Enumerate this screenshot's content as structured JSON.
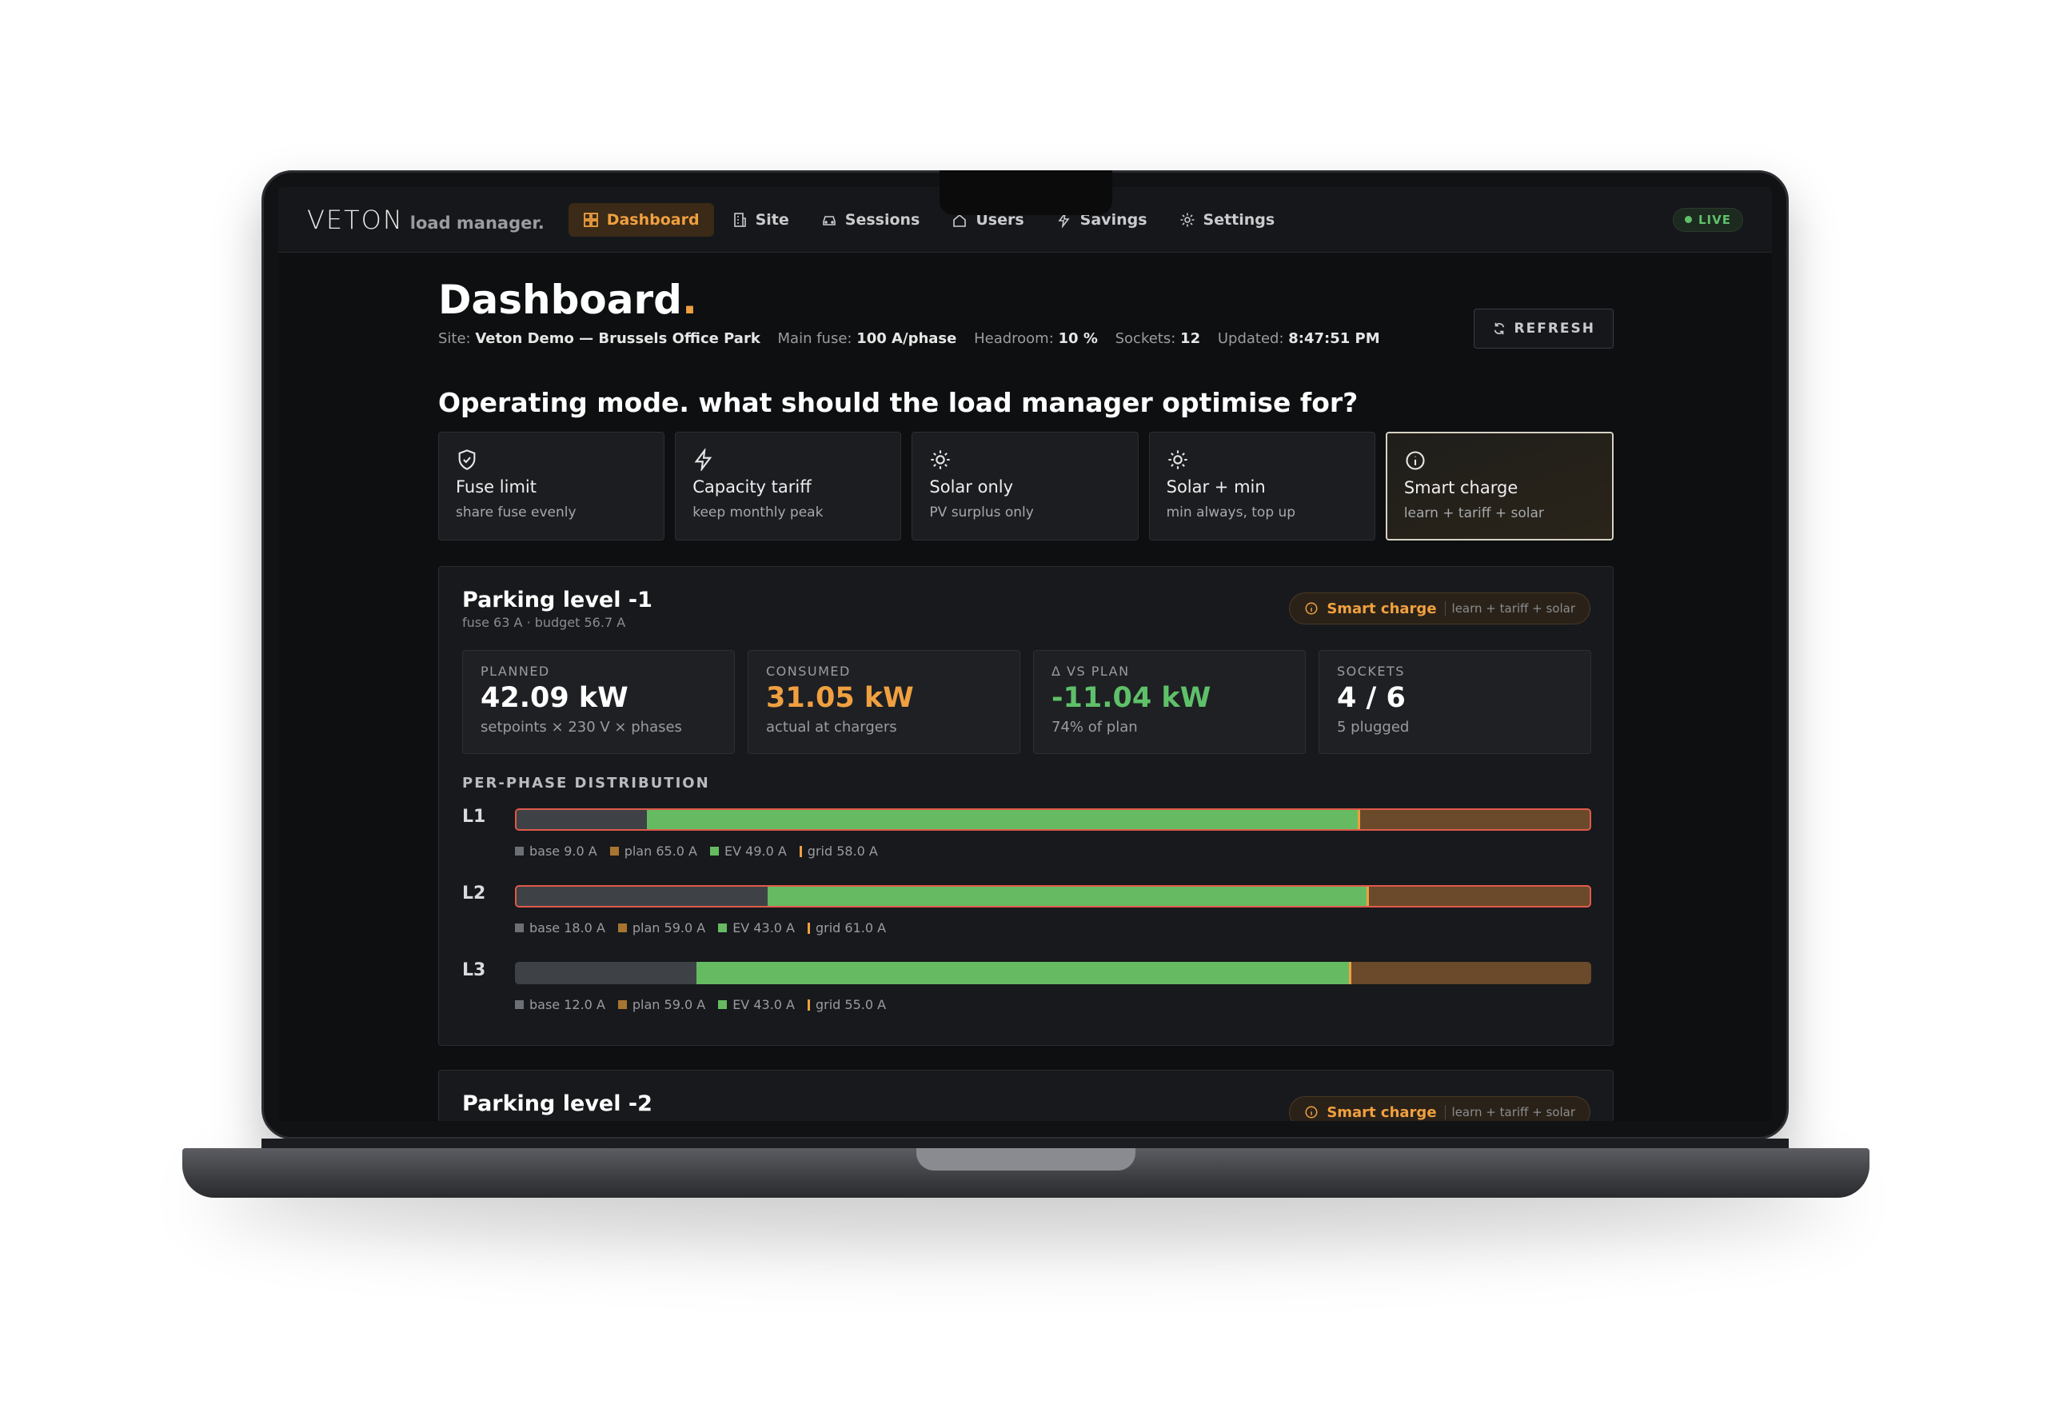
{
  "brand": {
    "name": "VETON",
    "sub": "load manager."
  },
  "nav": {
    "items": [
      {
        "label": "Dashboard",
        "icon": "dashboard-icon"
      },
      {
        "label": "Site",
        "icon": "building-icon"
      },
      {
        "label": "Sessions",
        "icon": "car-icon"
      },
      {
        "label": "Users",
        "icon": "home-icon"
      },
      {
        "label": "Savings",
        "icon": "bolt-icon"
      },
      {
        "label": "Settings",
        "icon": "gear-icon"
      }
    ],
    "live": "LIVE"
  },
  "header": {
    "title": "Dashboard",
    "title_dot": ".",
    "site_label": "Site:",
    "site_value": "Veton Demo — Brussels Office Park",
    "fuse_label": "Main fuse:",
    "fuse_value": "100 A/phase",
    "headroom_label": "Headroom:",
    "headroom_value": "10 %",
    "sockets_label": "Sockets:",
    "sockets_value": "12",
    "updated_label": "Updated:",
    "updated_value": "8:47:51 PM",
    "refresh": "REFRESH"
  },
  "operating": {
    "title": "Operating mode. what should the load manager optimise for?",
    "modes": [
      {
        "label": "Fuse limit",
        "desc": "share fuse evenly",
        "icon": "shield-icon"
      },
      {
        "label": "Capacity tariff",
        "desc": "keep monthly peak",
        "icon": "bolt-icon"
      },
      {
        "label": "Solar only",
        "desc": "PV surplus only",
        "icon": "sun-icon"
      },
      {
        "label": "Solar + min",
        "desc": "min always, top up",
        "icon": "sun-icon"
      },
      {
        "label": "Smart charge",
        "desc": "learn + tariff + solar",
        "icon": "info-icon",
        "selected": true
      }
    ]
  },
  "parking": [
    {
      "title": "Parking level -1",
      "sub": "fuse 63 A · budget 56.7 A",
      "mode_label": "Smart charge",
      "mode_desc": "learn + tariff + solar",
      "stats": [
        {
          "label": "PLANNED",
          "value": "42.09 kW",
          "sub": "setpoints × 230 V × phases"
        },
        {
          "label": "CONSUMED",
          "value": "31.05 kW",
          "sub": "actual at chargers"
        },
        {
          "label": "Δ VS PLAN",
          "value": "-11.04 kW",
          "sub": "74% of plan"
        },
        {
          "label": "SOCKETS",
          "value": "4 / 6",
          "sub": "5 plugged"
        }
      ],
      "dist_title": "PER-PHASE DISTRIBUTION",
      "phases": [
        {
          "name": "L1",
          "base": "base 9.0 A",
          "plan": "plan 65.0 A",
          "ev": "EV 49.0 A",
          "grid": "grid 58.0 A",
          "base_a": 9.0,
          "plan_a": 65.0,
          "ev_a": 49.0,
          "grid_a": 58.0,
          "alert": true
        },
        {
          "name": "L2",
          "base": "base 18.0 A",
          "plan": "plan 59.0 A",
          "ev": "EV 43.0 A",
          "grid": "grid 61.0 A",
          "base_a": 18.0,
          "plan_a": 59.0,
          "ev_a": 43.0,
          "grid_a": 61.0,
          "alert": true
        },
        {
          "name": "L3",
          "base": "base 12.0 A",
          "plan": "plan 59.0 A",
          "ev": "EV 43.0 A",
          "grid": "grid 55.0 A",
          "base_a": 12.0,
          "plan_a": 59.0,
          "ev_a": 43.0,
          "grid_a": 55.0,
          "alert": false
        }
      ]
    },
    {
      "title": "Parking level -2",
      "mode_label": "Smart charge",
      "mode_desc": "learn + tariff + solar"
    }
  ],
  "colors": {
    "accent": "#f0a040",
    "ev": "#66bb62",
    "base": "#3e4246",
    "plan": "#6a4a2a",
    "alert": "#e05a4a"
  }
}
